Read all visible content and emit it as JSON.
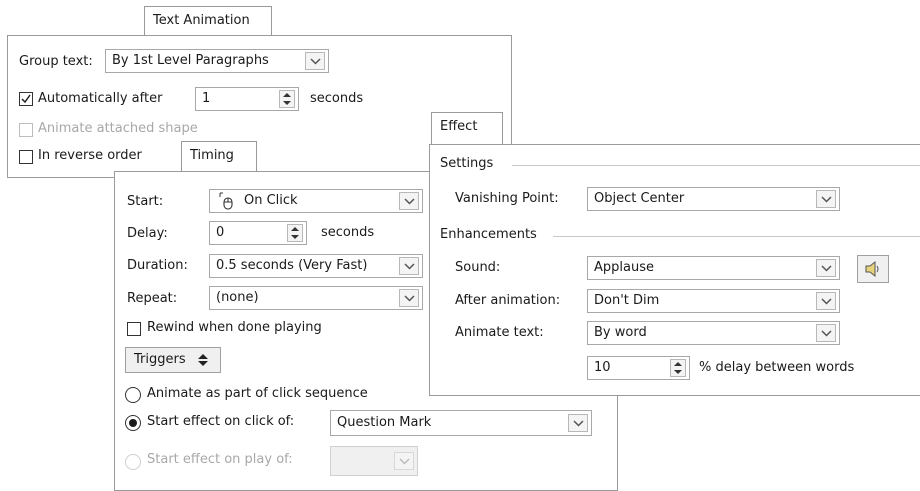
{
  "text_animation": {
    "tab_label": "Text Animation",
    "group_text_label": "Group text:",
    "group_text_value": "By 1st Level Paragraphs",
    "auto_after_label": "Automatically after",
    "auto_after_value": "1",
    "seconds_label": "seconds",
    "animate_shape_label": "Animate attached shape",
    "reverse_order_label": "In reverse order"
  },
  "timing": {
    "tab_label": "Timing",
    "start_label": "Start:",
    "start_value": "On Click",
    "delay_label": "Delay:",
    "delay_value": "0",
    "delay_unit": "seconds",
    "duration_label": "Duration:",
    "duration_value": "0.5 seconds (Very Fast)",
    "repeat_label": "Repeat:",
    "repeat_value": "(none)",
    "rewind_label": "Rewind when done playing",
    "triggers_label": "Triggers",
    "radio_sequence_label": "Animate as part of click sequence",
    "radio_click_label": "Start effect on click of:",
    "radio_click_value": "Question Mark",
    "radio_play_label": "Start effect on play of:"
  },
  "effect": {
    "tab_label": "Effect",
    "settings_heading": "Settings",
    "vanishing_label": "Vanishing Point:",
    "vanishing_value": "Object Center",
    "enhancements_heading": "Enhancements",
    "sound_label": "Sound:",
    "sound_value": "Applause",
    "after_label": "After animation:",
    "after_value": "Don't Dim",
    "animate_text_label": "Animate text:",
    "animate_text_value": "By word",
    "delay_value": "10",
    "delay_label": "% delay between words"
  }
}
